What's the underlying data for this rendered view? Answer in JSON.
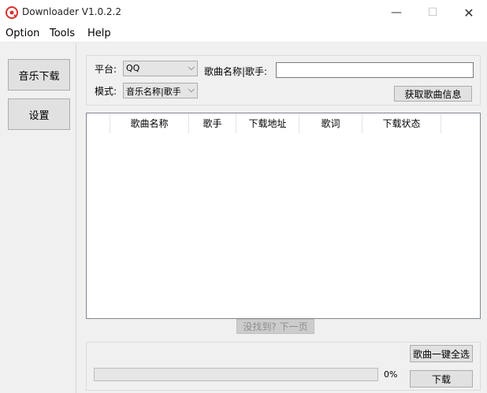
{
  "window": {
    "title": "Downloader V1.0.2.2",
    "app_icon": "music-disc-icon",
    "controls": {
      "minimize": "—",
      "maximize": "☐",
      "close": "✕"
    }
  },
  "menu": {
    "option": "Option",
    "tools": "Tools",
    "help": "Help"
  },
  "nav": {
    "music_download": "音乐下载",
    "settings": "设置"
  },
  "search": {
    "platform_label": "平台:",
    "platform_value": "QQ",
    "mode_label": "模式:",
    "mode_value": "音乐名称|歌手",
    "song_label": "歌曲名称|歌手:",
    "song_value": "",
    "fetch_button": "获取歌曲信息"
  },
  "table": {
    "columns": [
      "",
      "歌曲名称",
      "歌手",
      "下载地址",
      "歌词",
      "下载状态"
    ],
    "rows": []
  },
  "pager": {
    "next_page": "没找到? 下一页"
  },
  "bottom": {
    "select_all": "歌曲一键全选",
    "progress_text": "0%",
    "progress_value": 0,
    "download": "下载"
  },
  "colors": {
    "progress_fill": "#06b025",
    "icon_red": "#d9302c"
  }
}
